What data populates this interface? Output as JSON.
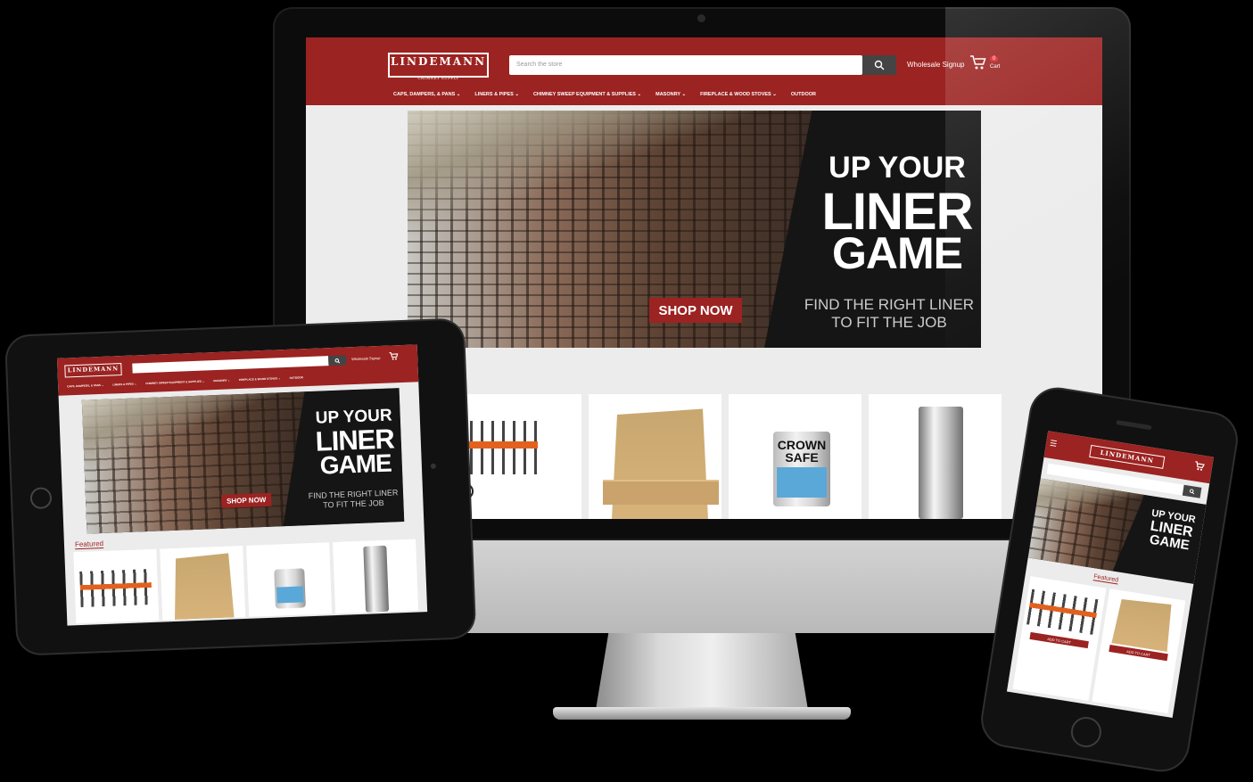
{
  "brand": {
    "name": "LINDEMANN",
    "tagline": "CHIMNEY SUPPLY"
  },
  "colors": {
    "brand_red": "#9b2321",
    "background": "#000000",
    "banner_dark": "#151515"
  },
  "header": {
    "search_placeholder": "Search the store",
    "search_icon": "search-icon",
    "wholesale_label": "Wholesale Signup",
    "cart_icon": "cart-icon",
    "cart_count": "0",
    "cart_label": "Cart"
  },
  "nav": {
    "items": [
      {
        "label": "CAPS, DAMPERS, & PANS ⌄"
      },
      {
        "label": "LINERS & PIPES ⌄"
      },
      {
        "label": "CHIMNEY SWEEP EQUIPMENT & SUPPLIES ⌄"
      },
      {
        "label": "MASONRY ⌄"
      },
      {
        "label": "FIREPLACE & WOOD STOVES ⌄"
      },
      {
        "label": "OUTDOOR"
      }
    ]
  },
  "banner": {
    "headline_1": "UP YOUR",
    "headline_2": "LINER",
    "headline_3": "GAME",
    "subline_1": "FIND THE RIGHT LINER",
    "subline_2": "TO FIT THE JOB",
    "cta": "SHOP NOW"
  },
  "featured": {
    "heading": "Featured",
    "products": [
      {
        "image": "rod-kit"
      },
      {
        "image": "firebricks"
      },
      {
        "image": "sealant-can",
        "can_text_1": "CROWN",
        "can_text_2": "SAFE"
      },
      {
        "image": "stainless-pipe"
      }
    ]
  },
  "phone": {
    "menu_icon": "menu-icon",
    "add_to_cart": "ADD TO CART"
  }
}
